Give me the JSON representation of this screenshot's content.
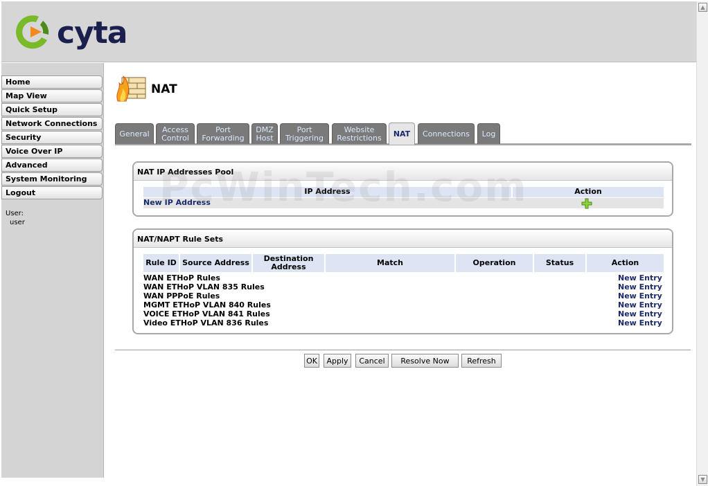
{
  "brand": {
    "logo_text": "cyta",
    "colors": {
      "green": "#7ab928",
      "orange": "#f08a1c",
      "navy": "#1b1f4d"
    }
  },
  "sidebar": {
    "items": [
      {
        "label": "Home"
      },
      {
        "label": "Map View"
      },
      {
        "label": "Quick Setup"
      },
      {
        "label": "Network Connections"
      },
      {
        "label": "Security"
      },
      {
        "label": "Voice Over IP"
      },
      {
        "label": "Advanced"
      },
      {
        "label": "System Monitoring"
      },
      {
        "label": "Logout"
      }
    ],
    "user_label": "User:",
    "user_name": "user"
  },
  "page": {
    "title": "NAT",
    "icon": "firewall-icon"
  },
  "tabs": [
    {
      "label": "General"
    },
    {
      "label": "Access Control"
    },
    {
      "label": "Port Forwarding"
    },
    {
      "label": "DMZ Host"
    },
    {
      "label": "Port Triggering"
    },
    {
      "label": "Website Restrictions"
    },
    {
      "label": "NAT",
      "active": true
    },
    {
      "label": "Connections"
    },
    {
      "label": "Log"
    }
  ],
  "pool": {
    "title": "NAT IP Addresses Pool",
    "col_ip": "IP Address",
    "col_action": "Action",
    "new_link": "New IP Address",
    "add_icon": "plus-icon"
  },
  "rules": {
    "title": "NAT/NAPT Rule Sets",
    "columns": [
      "Rule ID",
      "Source Address",
      "Destination Address",
      "Match",
      "Operation",
      "Status",
      "Action"
    ],
    "rows": [
      {
        "name": "WAN ETHoP Rules",
        "action": "New Entry"
      },
      {
        "name": "WAN ETHoP VLAN 835 Rules",
        "action": "New Entry"
      },
      {
        "name": "WAN PPPoE Rules",
        "action": "New Entry"
      },
      {
        "name": "MGMT ETHoP VLAN 840 Rules",
        "action": "New Entry"
      },
      {
        "name": "VOICE ETHoP VLAN 841 Rules",
        "action": "New Entry"
      },
      {
        "name": "Video ETHoP VLAN 836 Rules",
        "action": "New Entry"
      }
    ]
  },
  "buttons": {
    "ok": "OK",
    "apply": "Apply",
    "cancel": "Cancel",
    "resolve": "Resolve Now",
    "refresh": "Refresh"
  },
  "watermark": "PcWinTech.com"
}
